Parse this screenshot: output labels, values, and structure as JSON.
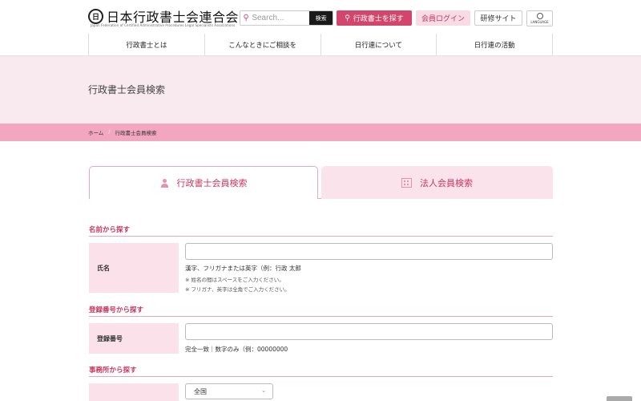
{
  "header": {
    "logo_seal": "日",
    "logo_title": "日本行政書士会連合会",
    "logo_subtitle": "Japan Federation of Certified Administrative Procedures Legal Specialists Associations",
    "search_placeholder": "Search...",
    "search_button": "検索",
    "find_button": "行政書士を探す",
    "login_button": "会員ログイン",
    "training_button": "研修サイト",
    "language_label": "LANGUAGE"
  },
  "nav": {
    "items": [
      "行政書士とは",
      "こんなときにご相談を",
      "日行連について",
      "日行連の活動"
    ]
  },
  "hero": {
    "title": "行政書士会員検索"
  },
  "breadcrumb": {
    "home": "ホーム",
    "separator": "/",
    "current": "行政書士会員検索"
  },
  "tabs": {
    "individual": "行政書士会員検索",
    "corporate": "法人会員検索"
  },
  "sections": {
    "name": {
      "title": "名前から探す",
      "label": "氏名",
      "value": "",
      "help": "漢字、フリガナまたは英字（例：行政 太郎",
      "note1": "※ 姓名の間はスペースをご入力ください。",
      "note2": "※ フリガナ、英字は全角でご入力ください。"
    },
    "registration": {
      "title": "登録番号から探す",
      "label": "登録番号",
      "value": "",
      "help": "完全一致｜数字のみ（例：00000000"
    },
    "office": {
      "title": "事務所から探す",
      "select_value": "全国"
    }
  },
  "colors": {
    "accent": "#d3456d",
    "accent_light": "#fbe1ea",
    "breadcrumb_bar": "#f2a6bf",
    "hero_bg": "#f8eaee"
  }
}
